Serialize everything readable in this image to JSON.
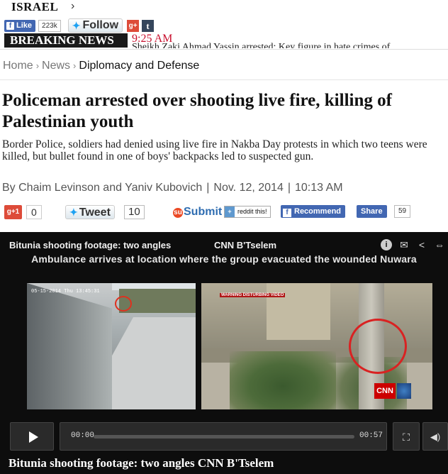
{
  "header": {
    "section": "ISRAEL",
    "section_chevron": "›",
    "facebook_like_label": "Like",
    "facebook_like_count": "223k",
    "twitter_follow_label": "Follow",
    "googleplus_label": "g+",
    "tumblr_label": "t"
  },
  "breaking": {
    "label": "BREAKING NEWS",
    "time": "9:25 AM",
    "ticker": "Sheikh Zaki Ahmad Yassin arrested: Key figure in hate crimes of"
  },
  "breadcrumb": {
    "items": [
      "Home",
      "News",
      "Diplomacy and Defense"
    ],
    "separator": "›"
  },
  "article": {
    "headline": "Policeman arrested over shooting live fire, killing of Palestinian youth",
    "subhead": "Border Police, soldiers had denied using live fire in Nakba Day protests in which two teens were killed, but bullet found in one of boys' backpacks led to suspected gun.",
    "authors": "By Chaim Levinson and Yaniv Kubovich",
    "date": "Nov. 12, 2014",
    "time": "10:13 AM",
    "byline_separator": "|"
  },
  "share": {
    "gplus_label": "g+1",
    "gplus_count": "0",
    "tweet_label": "Tweet",
    "tweet_count": "10",
    "stumble_label": "Submit",
    "reddit_label": "reddit this!",
    "reddit_plus": "+",
    "recommend_label": "Recommend",
    "share_label": "Share",
    "share_count": "59"
  },
  "video": {
    "title": "Bitunia shooting footage: two angles",
    "source": "CNN B'Tselem",
    "caption": "Ambulance arrives at location where the group evacuated the wounded Nuwara",
    "timestamp_overlay": "05-15-2014 Thu 13:45:31",
    "warning_overlay": "WARNING DISTURBING VIDEO",
    "network_logo": "CNN",
    "current_time": "00:00",
    "duration": "00:57",
    "progress": 0,
    "bottom_caption": "Bitunia shooting footage: two angles CNN B'Tselem"
  },
  "icons": {
    "info": "i",
    "mail": "✉",
    "share": "<",
    "embed": "⇔",
    "fullscreen": "⛶",
    "volume": "◀)"
  },
  "colors": {
    "breaking_red": "#c8102e",
    "facebook_blue": "#4267b2",
    "twitter_blue": "#1da1f2",
    "googleplus_red": "#dd4b39",
    "player_bg": "#0d0d0d"
  }
}
